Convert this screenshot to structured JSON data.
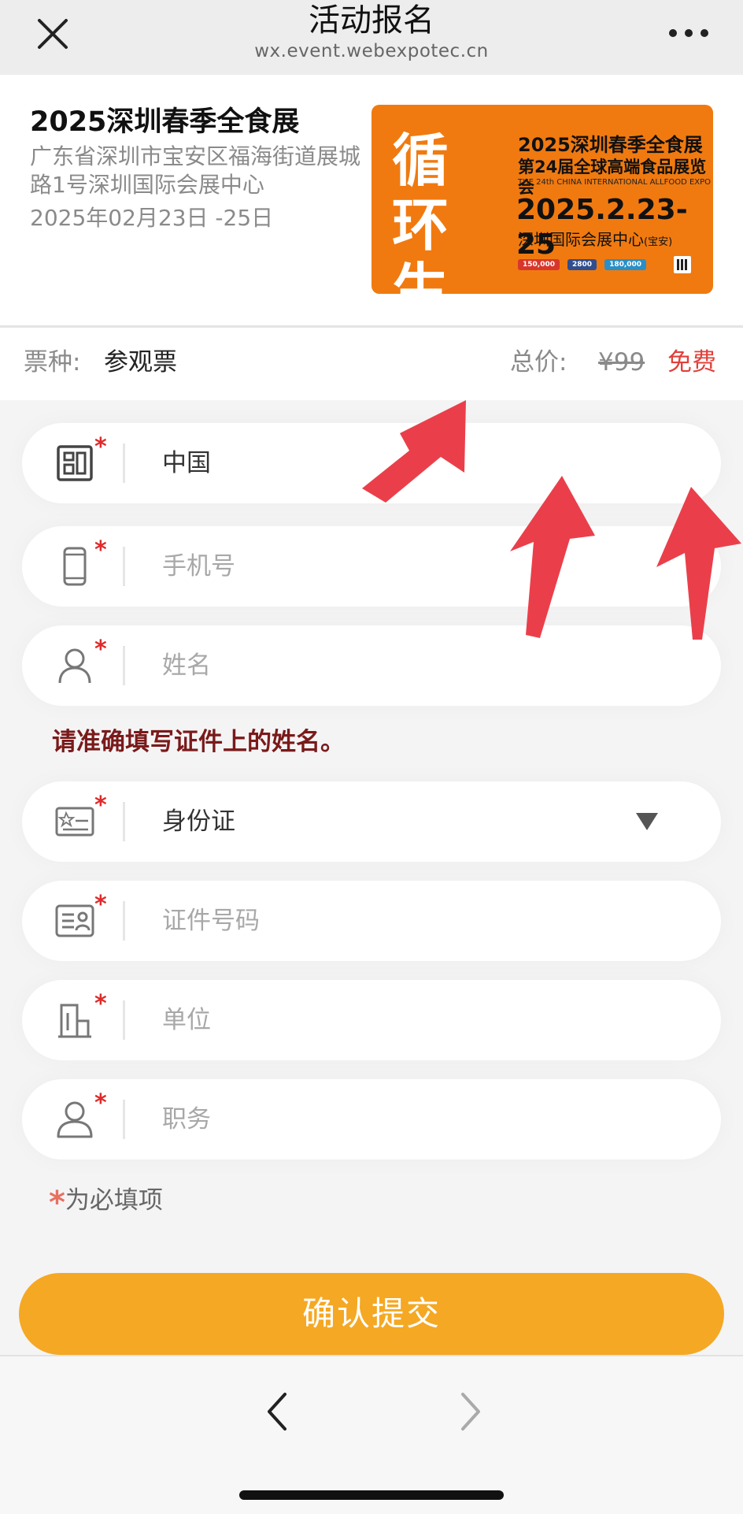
{
  "nav": {
    "title": "活动报名",
    "url": "wx.event.webexpotec.cn",
    "close_icon": "close-icon",
    "more_icon": "more-icon"
  },
  "event": {
    "name": "2025深圳春季全食展",
    "address": "广东省深圳市宝安区福海街道展城路1号深圳国际会展中心",
    "date": "2025年02月23日 -25日",
    "poster": {
      "slogan": "循环生长",
      "title": "2025深圳春季全食展",
      "subtitle": "第24届全球高端食品展览会",
      "english": "THE 24th CHINA INTERNATIONAL ALLFOOD EXPO",
      "dates": "2025.2.23-25",
      "venue": "深圳国际会展中心",
      "venue_note": "(宝安)",
      "stats": [
        "150,000",
        "2800",
        "180,000"
      ]
    }
  },
  "ticket": {
    "type_label": "票种:",
    "type_value": "参观票",
    "total_label": "总价:",
    "original_price": "¥99",
    "price": "免费"
  },
  "form": {
    "required_mark": "*",
    "fields": [
      {
        "icon": "country-icon",
        "value": "中国",
        "placeholder": ""
      },
      {
        "icon": "phone-icon",
        "value": "",
        "placeholder": "手机号"
      },
      {
        "icon": "person-icon",
        "value": "",
        "placeholder": "姓名"
      },
      {
        "icon": "id-card-icon",
        "value": "身份证",
        "placeholder": ""
      },
      {
        "icon": "id-number-icon",
        "value": "",
        "placeholder": "证件号码"
      },
      {
        "icon": "building-icon",
        "value": "",
        "placeholder": "单位"
      },
      {
        "icon": "job-person-icon",
        "value": "",
        "placeholder": "职务"
      }
    ],
    "name_hint": "请准确填写证件上的姓名。",
    "required_note": "为必填项",
    "submit_label": "确认提交"
  },
  "colors": {
    "accent": "#f5a823",
    "poster_orange": "#f07a10",
    "price_red": "#e0403a",
    "required_red": "#e02a2a",
    "hint_dark_red": "#7a1a1a",
    "annotation_red": "#ea3f4a"
  }
}
